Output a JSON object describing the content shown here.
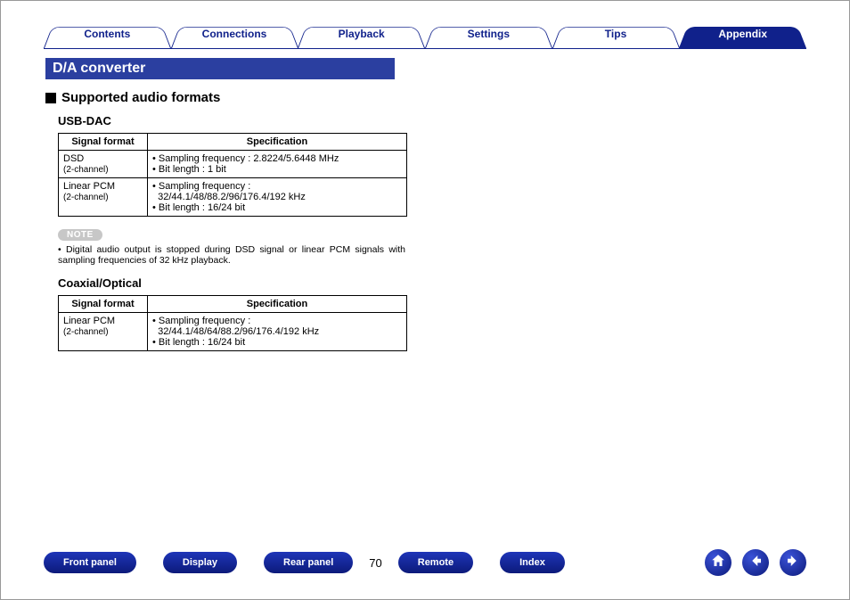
{
  "tabs": [
    {
      "label": "Contents",
      "active": false
    },
    {
      "label": "Connections",
      "active": false
    },
    {
      "label": "Playback",
      "active": false
    },
    {
      "label": "Settings",
      "active": false
    },
    {
      "label": "Tips",
      "active": false
    },
    {
      "label": "Appendix",
      "active": true
    }
  ],
  "section_title": "D/A converter",
  "h2": "Supported audio formats",
  "usb_dac": {
    "heading": "USB-DAC",
    "col1": "Signal format",
    "col2": "Specification",
    "rows": [
      {
        "fmt": "DSD",
        "fmt_sub": "(2-channel)",
        "spec1": "Sampling frequency : 2.8224/5.6448 MHz",
        "spec2": "Bit length : 1 bit"
      },
      {
        "fmt": "Linear PCM",
        "fmt_sub": "(2-channel)",
        "spec1": "Sampling frequency :",
        "spec1b": "32/44.1/48/88.2/96/176.4/192 kHz",
        "spec2": "Bit length : 16/24 bit"
      }
    ]
  },
  "note_label": "NOTE",
  "note_text": "Digital audio output is stopped during DSD signal or linear PCM signals with sampling frequencies of 32 kHz playback.",
  "coax": {
    "heading": "Coaxial/Optical",
    "col1": "Signal format",
    "col2": "Specification",
    "rows": [
      {
        "fmt": "Linear PCM",
        "fmt_sub": "(2-channel)",
        "spec1": "Sampling frequency :",
        "spec1b": "32/44.1/48/64/88.2/96/176.4/192 kHz",
        "spec2": "Bit length : 16/24 bit"
      }
    ]
  },
  "footer": {
    "front_panel": "Front panel",
    "display": "Display",
    "rear_panel": "Rear panel",
    "remote": "Remote",
    "index": "Index",
    "page": "70"
  }
}
